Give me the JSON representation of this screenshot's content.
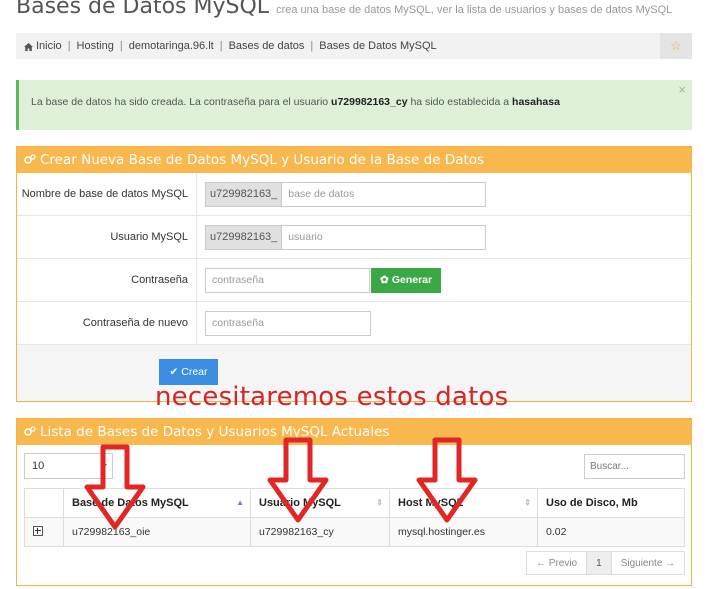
{
  "header": {
    "title": "Bases de Datos MySQL",
    "subtitle": "crea una base de datos MySQL, ver la lista de usuarios y bases de datos MySQL"
  },
  "breadcrumb": [
    "Inicio",
    "Hosting",
    "demotaringa.96.lt",
    "Bases de datos",
    "Bases de Datos MySQL"
  ],
  "alert": {
    "prefix": "La base de datos ha sido creada. La contraseña para el usuario ",
    "user": "u729982163_cy",
    "middle": " ha sido establecida a ",
    "password": "hasahasa",
    "close": "×"
  },
  "create_panel": {
    "title": "Crear Nueva Base de Datos MySQL y Usuario de la Base de Datos",
    "db_label": "Nombre de base de datos MySQL",
    "db_prefix": "u729982163_",
    "db_placeholder": "base de datos",
    "user_label": "Usuario MySQL",
    "user_prefix": "u729982163_",
    "user_placeholder": "usuario",
    "pass_label": "Contraseña",
    "pass_placeholder": "contraseña",
    "generate_label": "Generar",
    "repass_label": "Contraseña de nuevo",
    "repass_placeholder": "contraseña",
    "create_label": "Crear"
  },
  "annotation": "necesitaremos estos datos",
  "list_panel": {
    "title": "Lista de Bases de Datos y Usuarios MySQL Actuales",
    "page_length": "10",
    "search_placeholder": "Buscar...",
    "columns": [
      "Base de Datos MySQL",
      "Usuario MySQL",
      "Host MySQL",
      "Uso de Disco, Mb"
    ],
    "rows": [
      {
        "db": "u729982163_oie",
        "user": "u729982163_cy",
        "host": "mysql.hostinger.es",
        "disk": "0.02"
      }
    ],
    "pager": {
      "prev": "← Previo",
      "page": "1",
      "next": "Siguiente →"
    }
  },
  "colors": {
    "panel_header": "#f8b84e",
    "alert_bg": "#dff0d8",
    "generate_button": "#39a845",
    "create_button": "#3a8de1",
    "annotation": "#d42626"
  }
}
